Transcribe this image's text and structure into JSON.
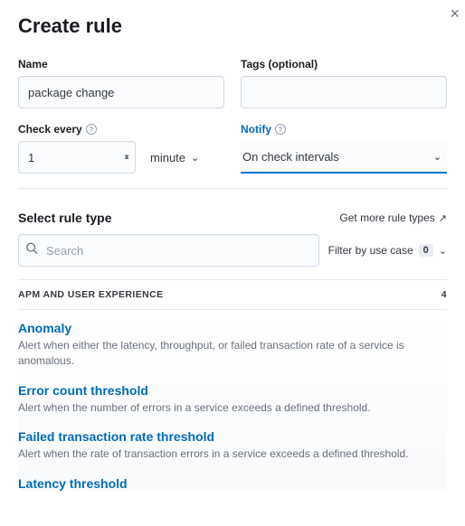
{
  "header": {
    "title": "Create rule"
  },
  "form": {
    "name_label": "Name",
    "name_value": "package change",
    "tags_label": "Tags (optional)",
    "tags_value": "",
    "check_every_label": "Check every",
    "check_every_value": "1",
    "check_every_unit": "minute",
    "notify_label": "Notify",
    "notify_value": "On check intervals"
  },
  "rule_type": {
    "title": "Select rule type",
    "more_link": "Get more rule types",
    "search_placeholder": "Search",
    "filter_label": "Filter by use case",
    "filter_count": "0",
    "category": {
      "name": "APM AND USER EXPERIENCE",
      "count": "4"
    },
    "items": [
      {
        "name": "Anomaly",
        "desc": "Alert when either the latency, throughput, or failed transaction rate of a service is anomalous."
      },
      {
        "name": "Error count threshold",
        "desc": "Alert when the number of errors in a service exceeds a defined threshold."
      },
      {
        "name": "Failed transaction rate threshold",
        "desc": "Alert when the rate of transaction errors in a service exceeds a defined threshold."
      },
      {
        "name": "Latency threshold",
        "desc": ""
      }
    ]
  }
}
